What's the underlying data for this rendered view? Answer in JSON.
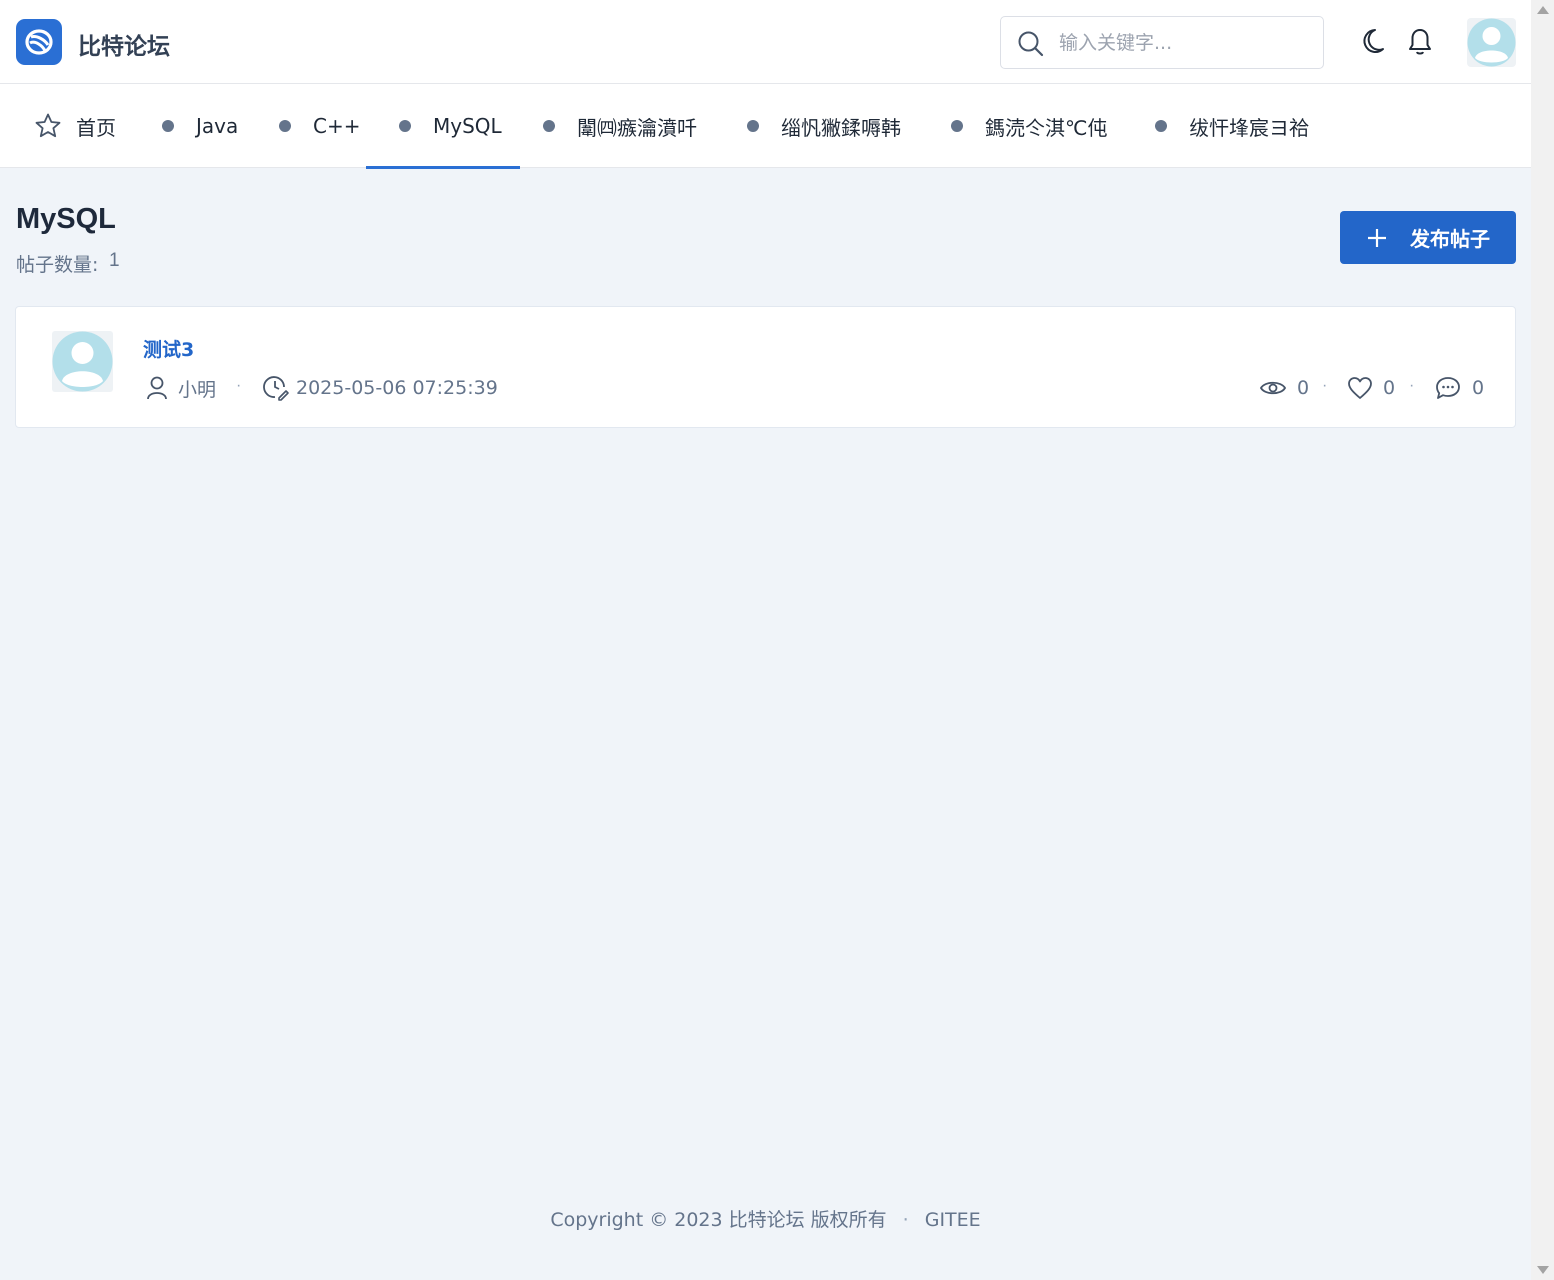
{
  "header": {
    "brand": "比特论坛",
    "search_placeholder": "输入关键字..."
  },
  "nav": {
    "home": "首页",
    "items": [
      "Java",
      "C++",
      "MySQL",
      "闈㈣瘯瀹濆吀",
      "缁忛獙鍒嗕韩",
      "鎷涜仒淇℃伅",
      "绂忓埄宸ヨ祫"
    ],
    "active": "MySQL"
  },
  "board": {
    "title": "MySQL",
    "count_label": "帖子数量:",
    "count_value": "1",
    "publish_label": "发布帖子"
  },
  "posts": [
    {
      "title": "测试3",
      "author": "小明",
      "time": "2025-05-06 07:25:39",
      "views": "0",
      "likes": "0",
      "comments": "0"
    }
  ],
  "footer": {
    "copyright": "Copyright © 2023 比特论坛 版权所有",
    "link": "GITEE"
  },
  "colors": {
    "accent": "#2366c9",
    "background": "#f0f4f9"
  }
}
